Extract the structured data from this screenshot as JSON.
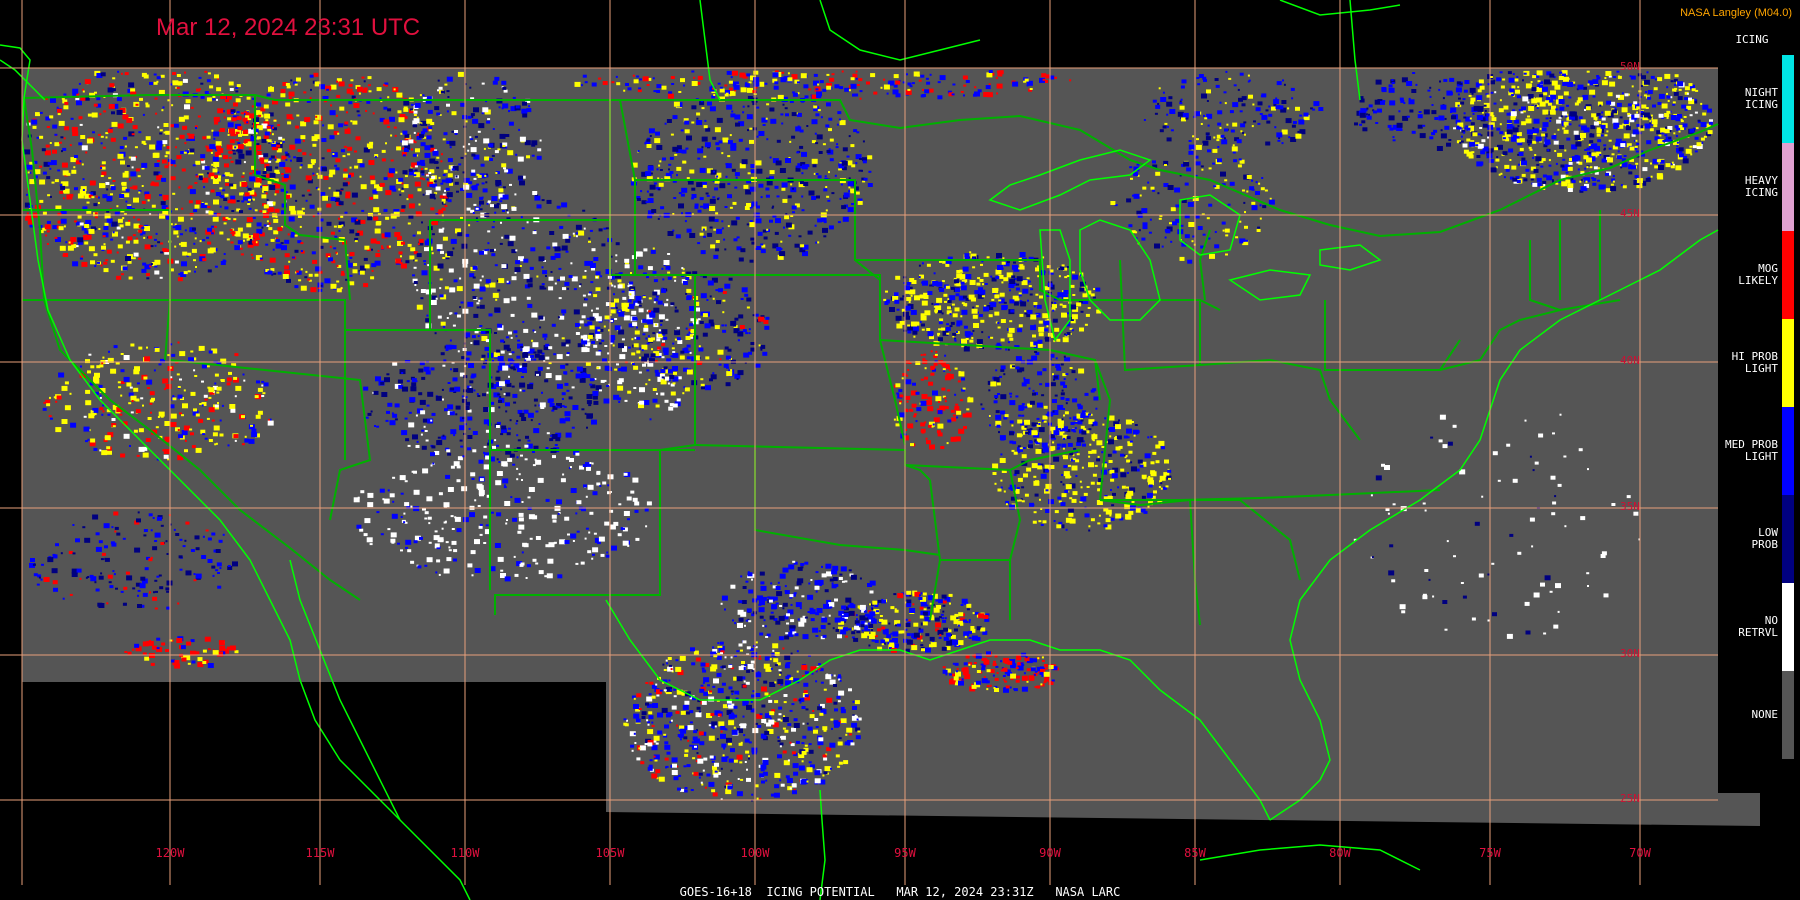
{
  "header": {
    "timestamp": "Mar 12, 2024 23:31 UTC",
    "credit": "NASA Langley (M04.0)"
  },
  "legend": {
    "title": "ICING",
    "entries": [
      {
        "label": "NIGHT\nICING",
        "color": "#00e5e5"
      },
      {
        "label": "HEAVY\nICING",
        "color": "#e0a0d0"
      },
      {
        "label": "MOG\nLIKELY",
        "color": "#ff0000"
      },
      {
        "label": "HI PROB\nLIGHT",
        "color": "#ffff00"
      },
      {
        "label": "MED PROB\nLIGHT",
        "color": "#0000ff"
      },
      {
        "label": "LOW\nPROB",
        "color": "#000080"
      },
      {
        "label": "NO\nRETRVL",
        "color": "#ffffff"
      },
      {
        "label": "NONE",
        "color": "#555555"
      }
    ]
  },
  "grid": {
    "longitudes": [
      "120W",
      "115W",
      "110W",
      "105W",
      "100W",
      "95W",
      "90W",
      "85W",
      "80W",
      "75W",
      "70W"
    ],
    "latitudes": [
      "50N",
      "45N",
      "40N",
      "35N",
      "30N",
      "25N"
    ],
    "line_color": "#e8a07a"
  },
  "map": {
    "background_color": "#555555",
    "border_color": "#00c000",
    "coast_color": "#00ff00"
  },
  "footer": {
    "text": "GOES-16+18  ICING POTENTIAL   MAR 12, 2024 23:31Z   NASA LARC"
  }
}
